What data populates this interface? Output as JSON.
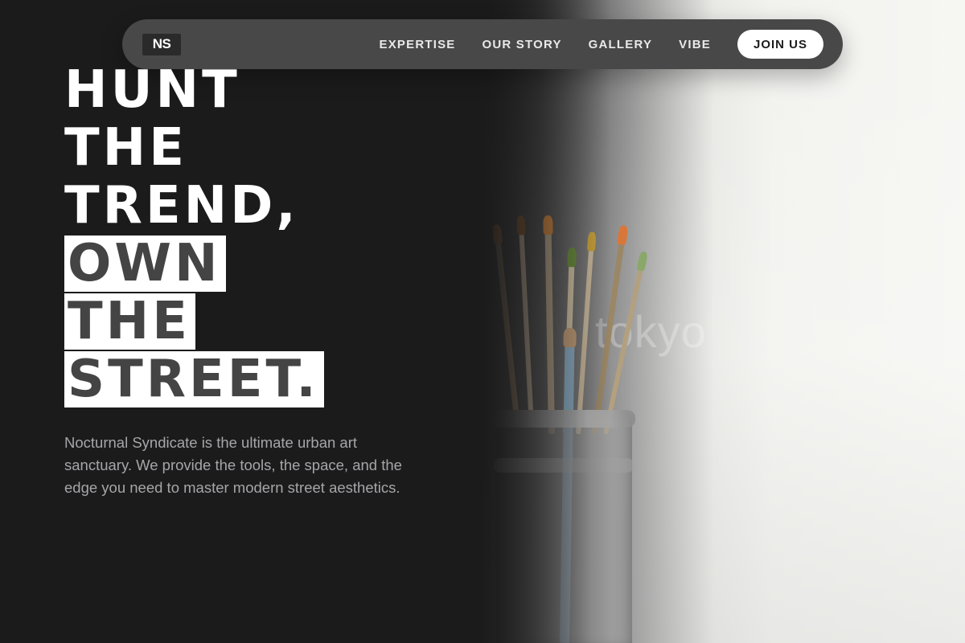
{
  "brand": {
    "logo": "NS"
  },
  "nav": {
    "links": [
      "EXPERTISE",
      "OUR STORY",
      "GALLERY",
      "VIBE"
    ],
    "cta": "JOIN US"
  },
  "hero": {
    "headline_lines": [
      "HUNT",
      "THE",
      "TREND,"
    ],
    "headline_highlight_lines": [
      "OWN",
      "THE",
      "STREET."
    ],
    "intro": "Nocturnal Syndicate is the ultimate urban art sanctuary. We provide the tools, the space, and the edge you need to master modern street aesthetics.",
    "image_watermark": "tokyo"
  },
  "colors": {
    "background": "#1b1b1c",
    "nav_background": "#484848",
    "highlight_background": "#ffffff",
    "highlight_text": "#444445",
    "intro_text": "#a6a6a9"
  }
}
